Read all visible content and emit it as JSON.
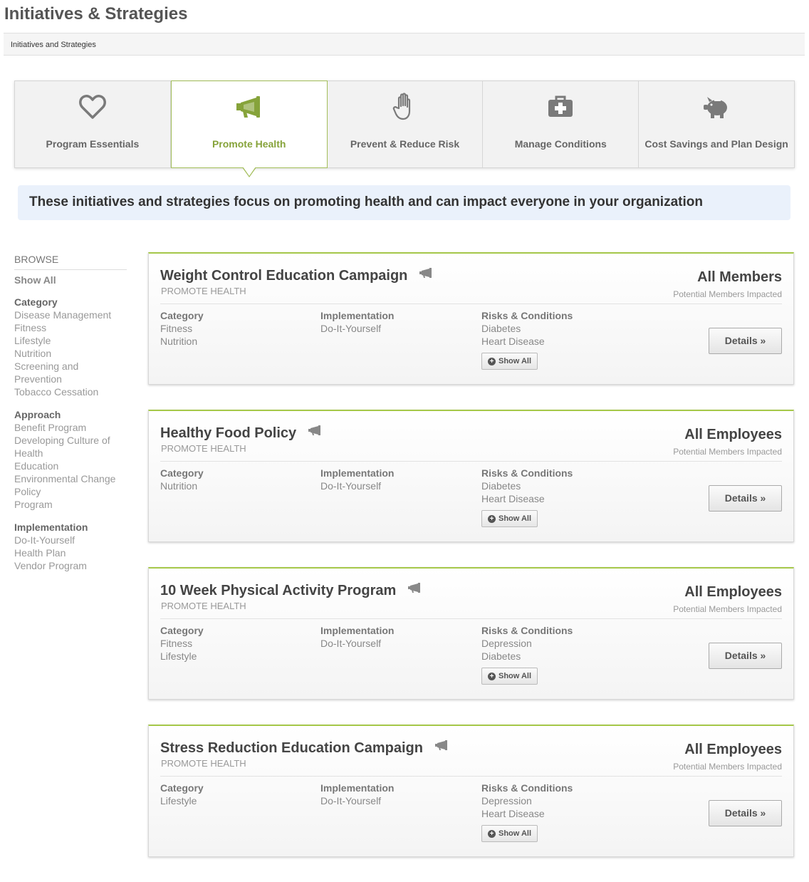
{
  "page": {
    "title": "Initiatives & Strategies"
  },
  "breadcrumb": {
    "label": "Initiatives and Strategies"
  },
  "tabs": [
    {
      "label": "Program Essentials",
      "icon": "heart-icon"
    },
    {
      "label": "Promote Health",
      "icon": "megaphone-icon",
      "active": true
    },
    {
      "label": "Prevent & Reduce Risk",
      "icon": "hand-icon"
    },
    {
      "label": "Manage Conditions",
      "icon": "first-aid-kit-icon"
    },
    {
      "label": "Cost Savings and Plan Design",
      "icon": "piggy-bank-icon"
    }
  ],
  "intro": "These initiatives and strategies focus on promoting health and can impact everyone in your organization",
  "sidebar": {
    "browse": "BROWSE",
    "show_all": "Show All",
    "groups": [
      {
        "heading": "Category",
        "items": [
          "Disease Management",
          "Fitness",
          "Lifestyle",
          "Nutrition",
          "Screening and Prevention",
          "Tobacco Cessation"
        ]
      },
      {
        "heading": "Approach",
        "items": [
          "Benefit Program",
          "Developing Culture of Health",
          "Education",
          "Environmental Change",
          "Policy",
          "Program"
        ]
      },
      {
        "heading": "Implementation",
        "items": [
          "Do-It-Yourself",
          "Health Plan",
          "Vendor Program"
        ]
      }
    ]
  },
  "labels": {
    "category": "Category",
    "implementation": "Implementation",
    "risks": "Risks & Conditions",
    "show_all": "Show All",
    "details": "Details »",
    "impacted": "Potential Members Impacted"
  },
  "cards": [
    {
      "title": "Weight Control Education Campaign",
      "subtitle": "PROMOTE HEALTH",
      "impact": "All Members",
      "category": [
        "Fitness",
        "Nutrition"
      ],
      "implementation": [
        "Do-It-Yourself"
      ],
      "risks": [
        "Diabetes",
        "Heart Disease"
      ]
    },
    {
      "title": "Healthy Food Policy",
      "subtitle": "PROMOTE HEALTH",
      "impact": "All Employees",
      "category": [
        "Nutrition"
      ],
      "implementation": [
        "Do-It-Yourself"
      ],
      "risks": [
        "Diabetes",
        "Heart Disease"
      ]
    },
    {
      "title": "10 Week Physical Activity Program",
      "subtitle": "PROMOTE HEALTH",
      "impact": "All Employees",
      "category": [
        "Fitness",
        "Lifestyle"
      ],
      "implementation": [
        "Do-It-Yourself"
      ],
      "risks": [
        "Depression",
        "Diabetes"
      ]
    },
    {
      "title": "Stress Reduction Education Campaign",
      "subtitle": "PROMOTE HEALTH",
      "impact": "All Employees",
      "category": [
        "Lifestyle"
      ],
      "implementation": [
        "Do-It-Yourself"
      ],
      "risks": [
        "Depression",
        "Heart Disease"
      ]
    }
  ],
  "colors": {
    "accent": "#86a33a",
    "accent_border": "#a6c84a",
    "intro_bg": "#eaf1fb",
    "icon_gray": "#7a7a7a"
  }
}
